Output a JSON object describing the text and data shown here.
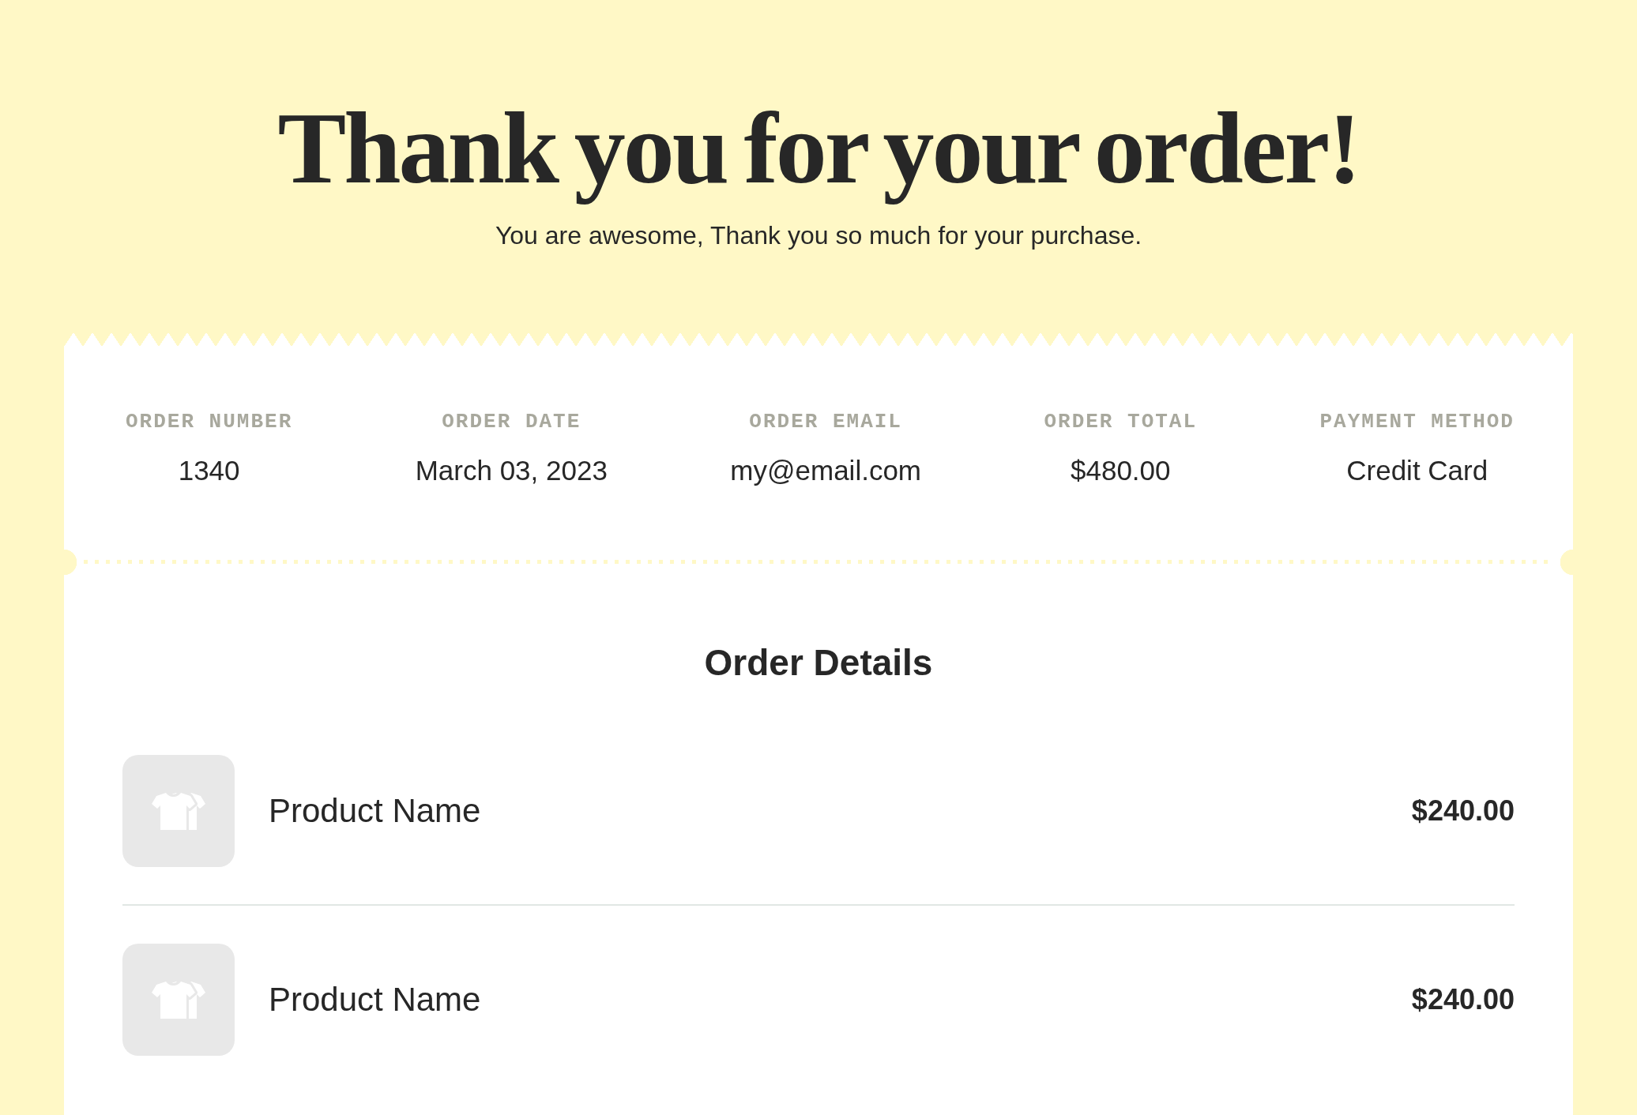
{
  "header": {
    "title": "Thank you for your order!",
    "subtitle": "You are awesome, Thank you so much for your purchase."
  },
  "order_summary": [
    {
      "label": "ORDER NUMBER",
      "value": "1340"
    },
    {
      "label": "ORDER DATE",
      "value": "March 03, 2023"
    },
    {
      "label": "ORDER EMAIL",
      "value": "my@email.com"
    },
    {
      "label": "ORDER TOTAL",
      "value": "$480.00"
    },
    {
      "label": "PAYMENT METHOD",
      "value": "Credit Card"
    }
  ],
  "order_details": {
    "heading": "Order Details",
    "items": [
      {
        "name": "Product Name",
        "price": "$240.00"
      },
      {
        "name": "Product Name",
        "price": "$240.00"
      }
    ]
  }
}
